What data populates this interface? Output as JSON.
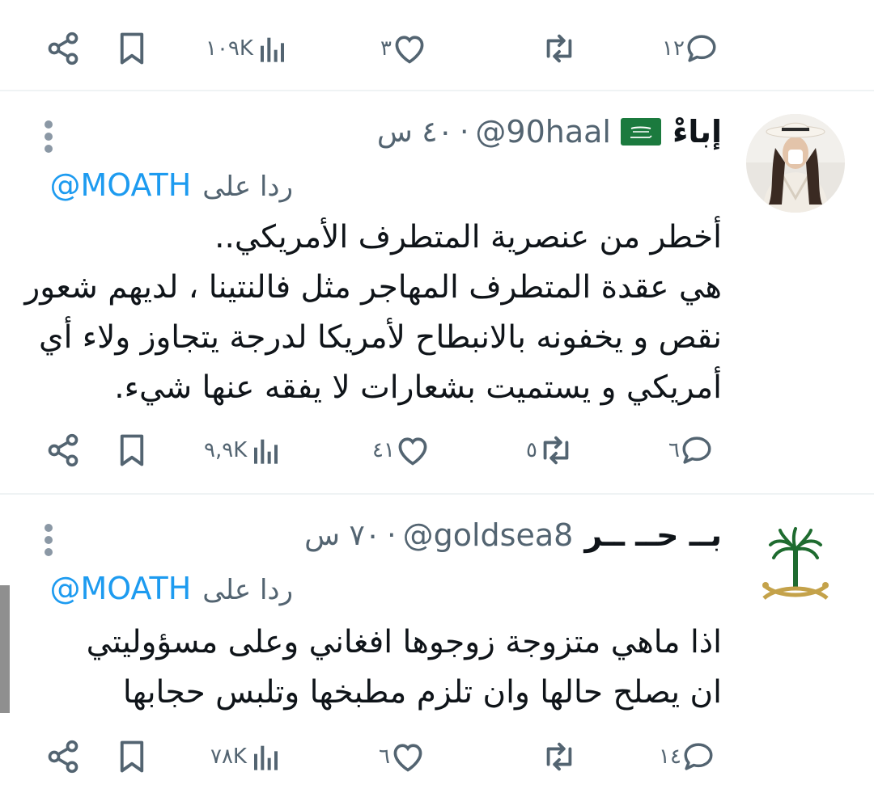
{
  "actions_top": {
    "replies": "١٢",
    "reposts": "",
    "likes": "٣",
    "views": "١٠٩K"
  },
  "tweets": [
    {
      "display_name": "إباءْ",
      "flag": "🇸🇦",
      "handle": "@90haal",
      "time": "٤٠ س",
      "replying_to_label": "ردا على",
      "replying_to_handle": "@MOATH",
      "text_lines": [
        "أخطر من عنصرية المتطرف الأمريكي..",
        "هي عقدة المتطرف المهاجر مثل فالنتينا ، لديهم شعور",
        "نقص و يخفونه بالانبطاح لأمريكا لدرجة يتجاوز ولاء أي",
        "أمريكي و يستميت بشعارات لا يفقه عنها شيء."
      ],
      "actions": {
        "replies": "٦",
        "reposts": "٥",
        "likes": "٤١",
        "views": "٩,٩K"
      }
    },
    {
      "display_name": "بــ حــ ــر",
      "handle": "@goldsea8",
      "time": "٧٠ س",
      "replying_to_label": "ردا على",
      "replying_to_handle": "@MOATH",
      "text_lines": [
        "اذا ماهي متزوجة زوجوها افغاني وعلى مسؤوليتي",
        "ان يصلح حالها وان تلزم مطبخها وتلبس حجابها"
      ],
      "actions": {
        "replies": "١٤",
        "reposts": "",
        "likes": "٦",
        "views": "٧٨K"
      }
    }
  ],
  "colors": {
    "text": "#0f1419",
    "secondary": "#536471",
    "link": "#1d9bf0",
    "divider": "#eff3f4"
  },
  "icons": [
    "share-icon",
    "bookmark-icon",
    "views-icon",
    "like-icon",
    "repost-icon",
    "reply-icon",
    "more-icon"
  ]
}
